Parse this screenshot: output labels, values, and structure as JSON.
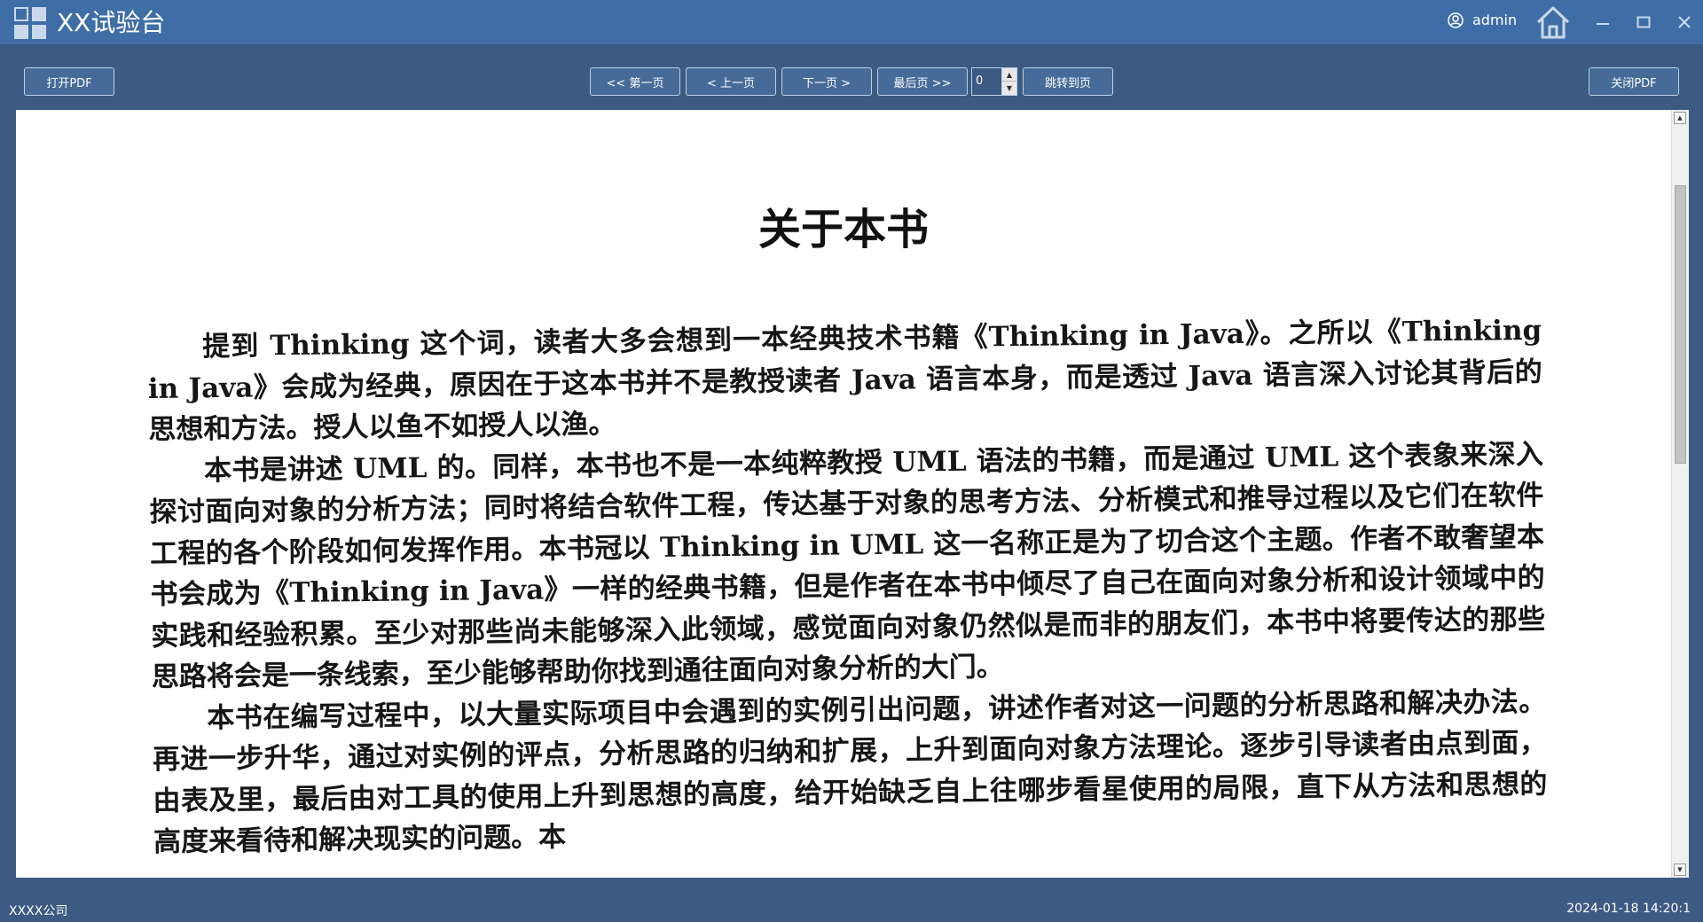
{
  "window": {
    "title": "XX试验台",
    "user": "admin",
    "controls": [
      "minimize-icon",
      "maximize-icon",
      "close-icon"
    ],
    "icons": {
      "logo": "grid-logo-icon",
      "user": "user-icon",
      "home": "home-icon"
    }
  },
  "toolbar": {
    "open_pdf": "打开PDF",
    "first_page": "<< 第一页",
    "prev_page": "< 上一页",
    "next_page": "下一页 >",
    "last_page": "最后页 >>",
    "page_number": "0",
    "jump_to_page": "跳转到页",
    "close_pdf": "关闭PDF"
  },
  "document": {
    "title": "关于本书",
    "paragraphs": [
      "提到 Thinking 这个词，读者大多会想到一本经典技术书籍《Thinking in Java》。之所以《Thinking in Java》会成为经典，原因在于这本书并不是教授读者 Java 语言本身，而是透过 Java 语言深入讨论其背后的思想和方法。授人以鱼不如授人以渔。",
      "本书是讲述 UML 的。同样，本书也不是一本纯粹教授 UML 语法的书籍，而是通过 UML 这个表象来深入探讨面向对象的分析方法；同时将结合软件工程，传达基于对象的思考方法、分析模式和推导过程以及它们在软件工程的各个阶段如何发挥作用。本书冠以 Thinking in UML 这一名称正是为了切合这个主题。作者不敢奢望本书会成为《Thinking in Java》一样的经典书籍，但是作者在本书中倾尽了自己在面向对象分析和设计领域中的实践和经验积累。至少对那些尚未能够深入此领域，感觉面向对象仍然似是而非的朋友们，本书中将要传达的那些思路将会是一条线索，至少能够帮助你找到通往面向对象分析的大门。",
      "本书在编写过程中，以大量实际项目中会遇到的实例引出问题，讲述作者对这一问题的分析思路和解决办法。再进一步升华，通过对实例的评点，分析思路的归纳和扩展，上升到面向对象方法理论。逐步引导读者由点到面，由表及里，最后由对工具的使用上升到思想的高度，给开始缺乏自上往哪步看星使用的局限，直下从方法和思想的高度来看待和解决现实的问题。本"
    ]
  },
  "statusbar": {
    "company": "XXXX公司",
    "datetime": "2024-01-18 14:20:1"
  },
  "colors": {
    "titlebar": "#3f6ea6",
    "background": "#3c5a82",
    "button": "#466b98",
    "button_border": "#bcd0e6"
  }
}
